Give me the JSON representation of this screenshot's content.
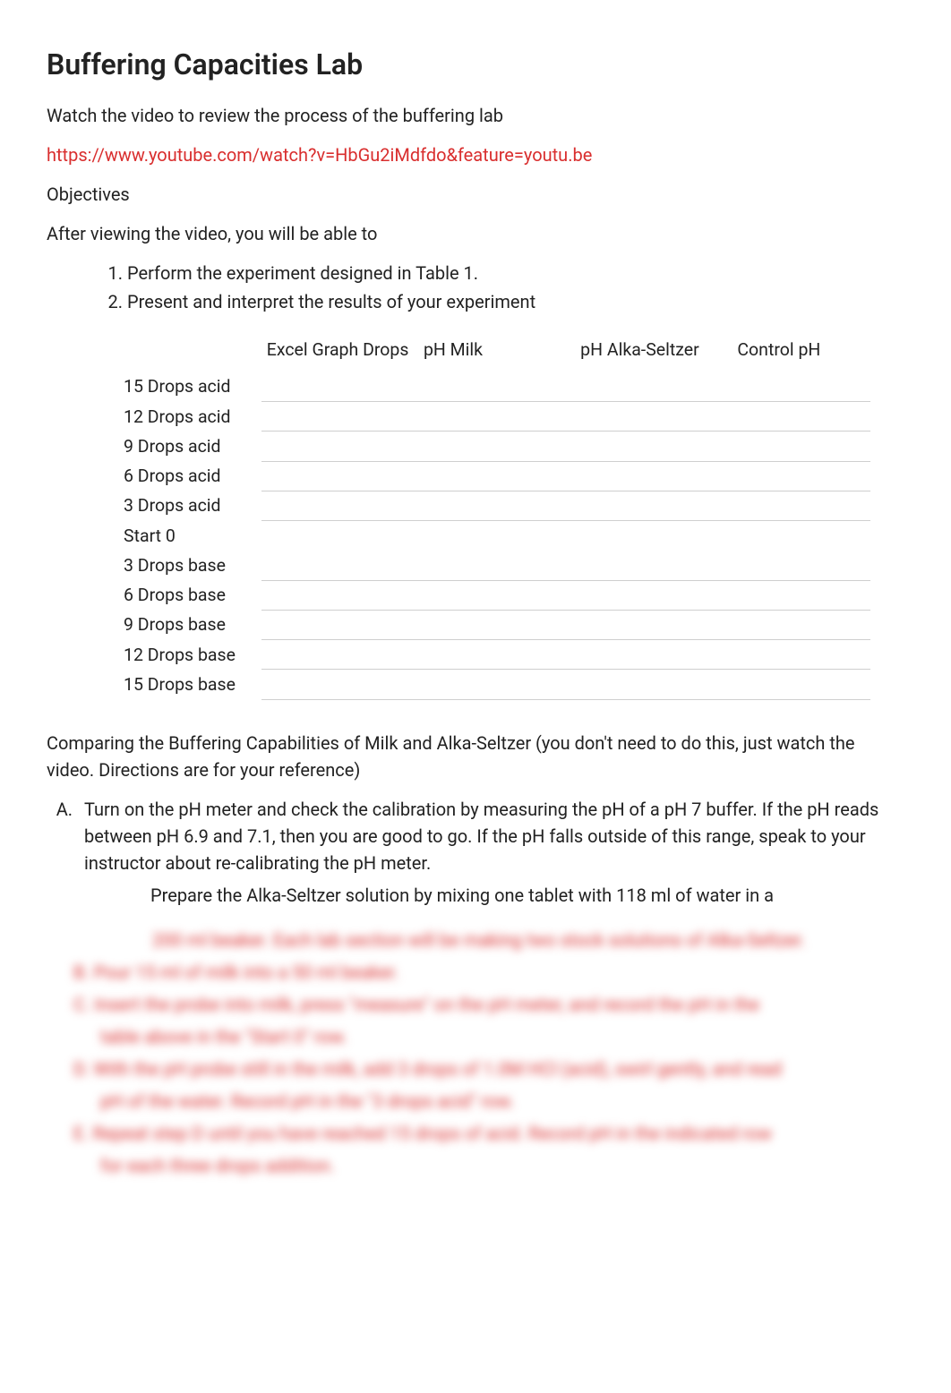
{
  "title": "Buffering Capacities Lab",
  "intro": "Watch the video to review the process of the buffering lab",
  "link": "https://www.youtube.com/watch?v=HbGu2iMdfdo&feature=youtu.be",
  "objectives_label": "Objectives",
  "after_viewing": "After viewing the video, you will be able to",
  "objectives": [
    "Perform the experiment designed in Table 1.",
    "Present and interpret the results of your experiment"
  ],
  "table": {
    "headers": [
      "",
      "Excel Graph Drops",
      "pH Milk",
      "pH Alka-Seltzer",
      "Control pH"
    ],
    "rows": [
      "15 Drops acid",
      "12 Drops acid",
      "9 Drops acid",
      "6 Drops acid",
      "3 Drops acid",
      "Start 0",
      "3 Drops base",
      "6 Drops base",
      "9 Drops base",
      "12 Drops base",
      "15 Drops base"
    ]
  },
  "compare": "Comparing the Buffering Capabilities of Milk and Alka-Seltzer (you don't need to do this, just watch the video. Directions are for your reference)",
  "procedure": {
    "A": "Turn on the pH meter and check the calibration by measuring the pH of a pH 7 buffer. If the pH reads between pH 6.9 and 7.1, then you are good to go. If the pH falls outside of this range, speak to your instructor about re-calibrating the pH meter.",
    "A_sub": "Prepare the Alka-Seltzer solution by mixing one tablet with 118 ml of water in a"
  },
  "blurred": [
    "200 ml beaker. Each lab section will be making two stock solutions of Alka-Seltzer.",
    "B.  Pour 15 ml of milk into a 50 ml beaker.",
    "C.  Insert the probe into milk, press \"measure\" on the pH meter, and record the pH in the",
    "table above in the \"Start 0\" row.",
    "D.  With the pH probe still in the milk, add 3 drops of 1.0M HCl (acid), swirl gently, and read",
    "pH of the water. Record pH in the \"3 drops acid\" row.",
    "E.  Repeat step D until you have reached 15 drops of acid. Record pH in the indicated row",
    "for each three drops addition."
  ]
}
